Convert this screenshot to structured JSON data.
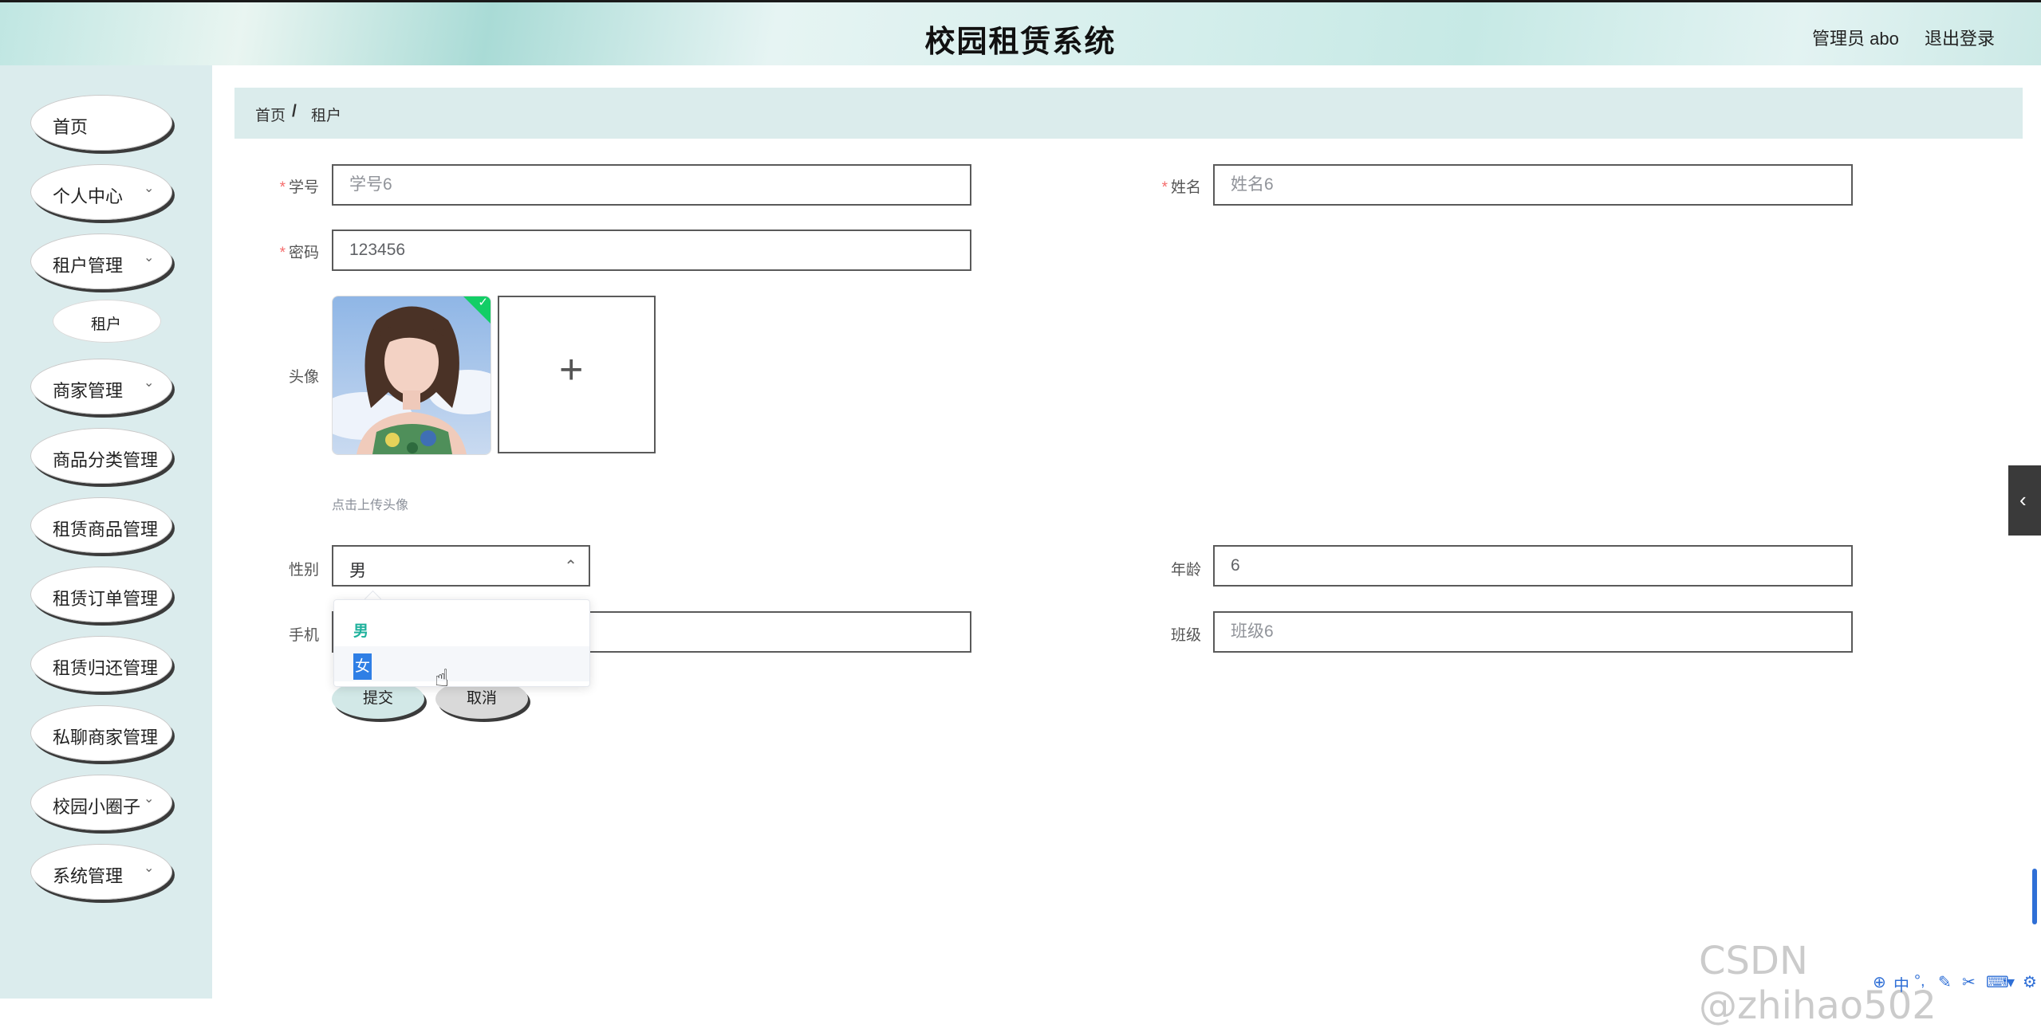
{
  "header": {
    "title": "校园租赁系统",
    "user": "管理员 abo",
    "logout": "退出登录"
  },
  "sidebar": {
    "items": [
      {
        "label": "首页",
        "has_children": false
      },
      {
        "label": "个人中心",
        "has_children": true
      },
      {
        "label": "租户管理",
        "has_children": true
      },
      {
        "label": "商家管理",
        "has_children": true
      },
      {
        "label": "商品分类管理",
        "has_children": false
      },
      {
        "label": "租赁商品管理",
        "has_children": false
      },
      {
        "label": "租赁订单管理",
        "has_children": false
      },
      {
        "label": "租赁归还管理",
        "has_children": false
      },
      {
        "label": "私聊商家管理",
        "has_children": false
      },
      {
        "label": "校园小圈子",
        "has_children": true
      },
      {
        "label": "系统管理",
        "has_children": true
      }
    ],
    "sub_item": "租户"
  },
  "breadcrumb": {
    "home": "首页",
    "separator": "/",
    "current": "租户"
  },
  "form": {
    "student_id": {
      "label": "学号",
      "value": "学号6",
      "required": true
    },
    "name": {
      "label": "姓名",
      "value": "姓名6",
      "required": true
    },
    "password": {
      "label": "密码",
      "value": "123456",
      "required": true
    },
    "avatar": {
      "label": "头像",
      "upload_plus": "+",
      "tip": "点击上传头像"
    },
    "gender": {
      "label": "性别",
      "value": "男",
      "options": [
        "男",
        "女"
      ]
    },
    "age": {
      "label": "年龄",
      "value": "6"
    },
    "phone": {
      "label": "手机",
      "value": ""
    },
    "class": {
      "label": "班级",
      "value": "班级6"
    },
    "submit": "提交",
    "cancel": "取消"
  },
  "icons": {
    "chevron": "chevron-down-icon",
    "select_arrow": "chevron-up-icon",
    "side_tab": "chevron-left-icon",
    "success_check": "check-icon",
    "cursor": "hand-pointer-icon"
  },
  "colors": {
    "accent": "#1fb19c",
    "required": "#f56c6c",
    "sidebar_bg": "#dbeced",
    "breadcrumb_bg": "#dbecec"
  },
  "watermark": "CSDN @zhihao502",
  "tray": {
    "ime": "中",
    "punct": "°,"
  }
}
